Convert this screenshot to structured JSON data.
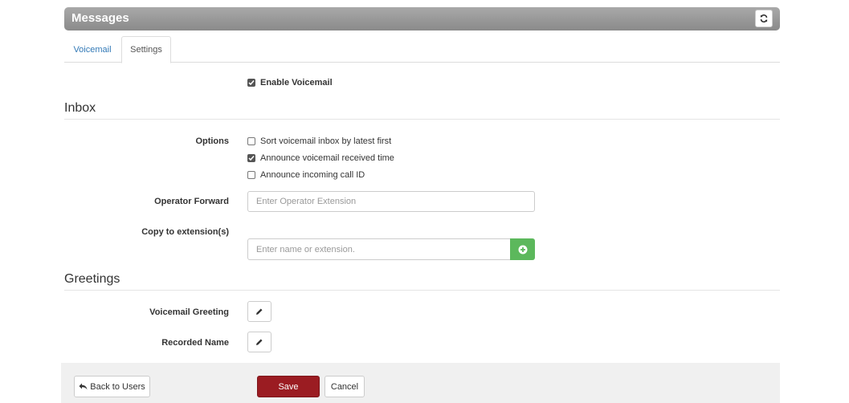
{
  "panel": {
    "title": "Messages",
    "refresh_icon": "refresh-icon"
  },
  "tabs": [
    {
      "label": "Voicemail",
      "active": false
    },
    {
      "label": "Settings",
      "active": true
    }
  ],
  "enable_voicemail": {
    "label": "Enable Voicemail",
    "checked": true
  },
  "inbox": {
    "title": "Inbox",
    "options_label": "Options",
    "options": [
      {
        "label": "Sort voicemail inbox by latest first",
        "checked": false
      },
      {
        "label": "Announce voicemail received time",
        "checked": true
      },
      {
        "label": "Announce incoming call ID",
        "checked": false
      }
    ],
    "operator_forward": {
      "label": "Operator Forward",
      "placeholder": "Enter Operator Extension",
      "value": ""
    },
    "copy_to": {
      "label": "Copy to extension(s)",
      "placeholder": "Enter name or extension.",
      "value": ""
    }
  },
  "greetings": {
    "title": "Greetings",
    "voicemail_greeting_label": "Voicemail Greeting",
    "recorded_name_label": "Recorded Name"
  },
  "footer": {
    "back_label": "Back to Users",
    "save_label": "Save",
    "cancel_label": "Cancel"
  },
  "colors": {
    "header": "#8a8a8a",
    "link": "#337ab7",
    "save": "#9b1c22",
    "add": "#5cb85c"
  }
}
